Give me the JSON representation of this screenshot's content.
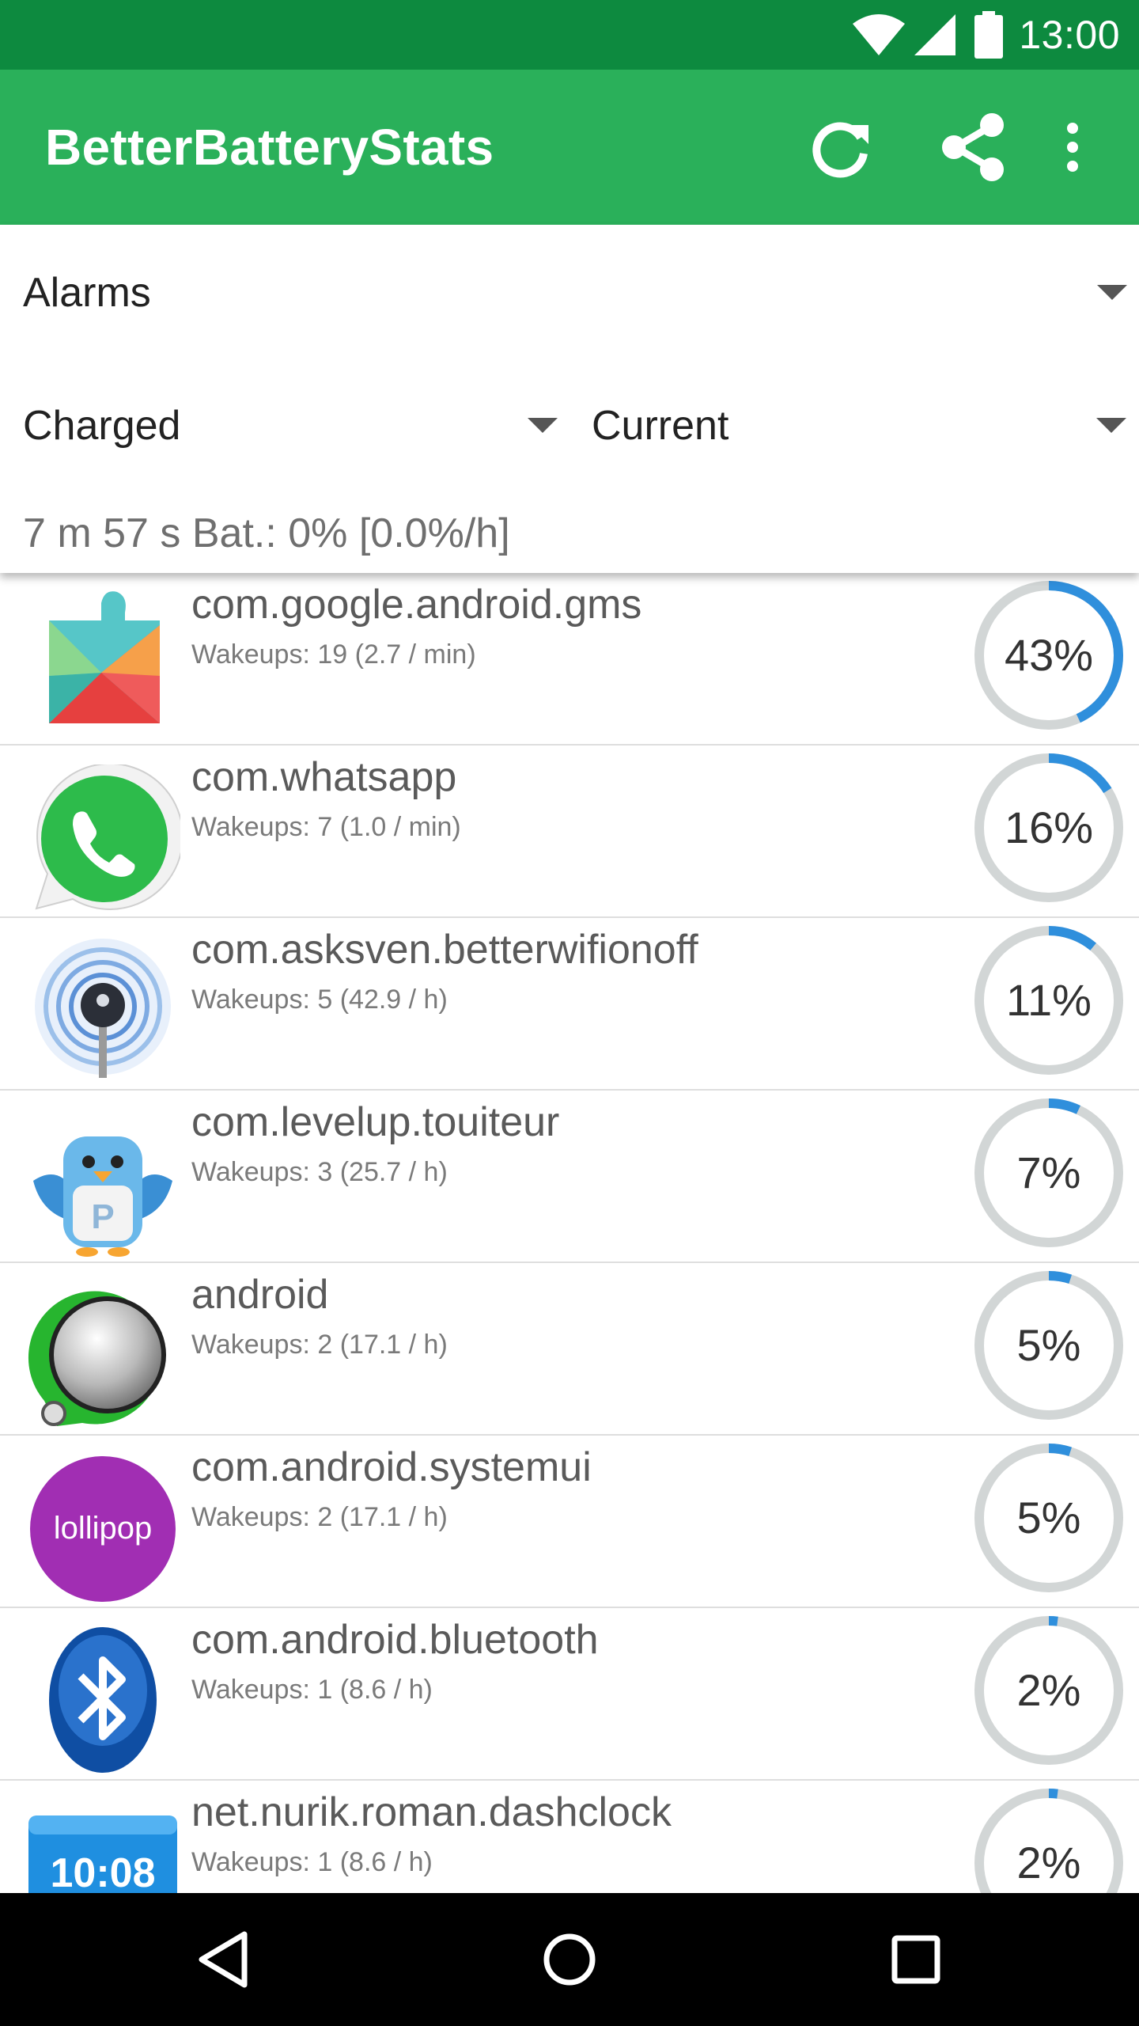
{
  "status": {
    "time": "13:00"
  },
  "app": {
    "title": "BetterBatteryStats"
  },
  "filters": {
    "stat_type": "Alarms",
    "from": "Charged",
    "to": "Current",
    "summary": "7 m 57 s  Bat.: 0% [0.0%/h]"
  },
  "colors": {
    "status_bar": "#0d8a3f",
    "app_bar": "#2ab05a",
    "gauge_fill": "#2f8fdc",
    "gauge_track": "#d2d6d6"
  },
  "items": [
    {
      "name": "com.google.android.gms",
      "wakeups": "Wakeups: 19 (2.7 / min)",
      "percent_label": "43%",
      "percent": 43,
      "icon": "google-play-services-icon"
    },
    {
      "name": "com.whatsapp",
      "wakeups": "Wakeups: 7 (1.0 / min)",
      "percent_label": "16%",
      "percent": 16,
      "icon": "whatsapp-icon"
    },
    {
      "name": "com.asksven.betterwifionoff",
      "wakeups": "Wakeups: 5 (42.9 / h)",
      "percent_label": "11%",
      "percent": 11,
      "icon": "wifi-robot-icon"
    },
    {
      "name": "com.levelup.touiteur",
      "wakeups": "Wakeups: 3 (25.7 / h)",
      "percent_label": "7%",
      "percent": 7,
      "icon": "bird-icon"
    },
    {
      "name": "android",
      "wakeups": "Wakeups: 2 (17.1 / h)",
      "percent_label": "5%",
      "percent": 5,
      "icon": "android-system-icon"
    },
    {
      "name": "com.android.systemui",
      "wakeups": "Wakeups: 2 (17.1 / h)",
      "percent_label": "5%",
      "percent": 5,
      "icon": "lollipop-icon",
      "icon_text": "lollipop"
    },
    {
      "name": "com.android.bluetooth",
      "wakeups": "Wakeups: 1 (8.6 / h)",
      "percent_label": "2%",
      "percent": 2,
      "icon": "bluetooth-icon"
    },
    {
      "name": "net.nurik.roman.dashclock",
      "wakeups": "Wakeups: 1 (8.6 / h)",
      "percent_label": "2%",
      "percent": 2,
      "icon": "dashclock-icon",
      "icon_text": "10:08"
    }
  ]
}
